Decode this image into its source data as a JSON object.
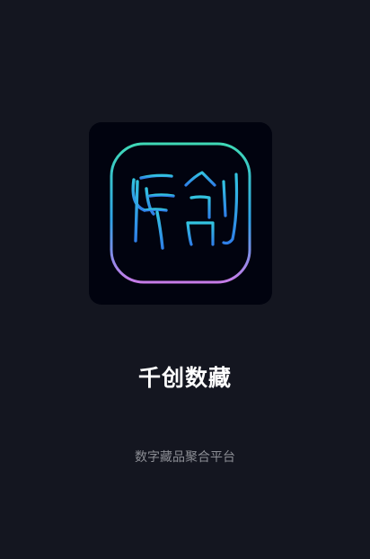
{
  "app": {
    "name": "千创数藏",
    "tagline": "数字藏品聚合平台"
  },
  "logo": {
    "icon": "seal-script-logo-icon",
    "glyph_text": "仟創",
    "tile_color": "#01030f",
    "gradient_top": "#3fd9b6",
    "gradient_mid": "#2fa2e6",
    "gradient_bottom": "#c77ce8"
  },
  "theme": {
    "background": "#141620",
    "title_color": "#ffffff",
    "tagline_color": "#8b8d94"
  }
}
